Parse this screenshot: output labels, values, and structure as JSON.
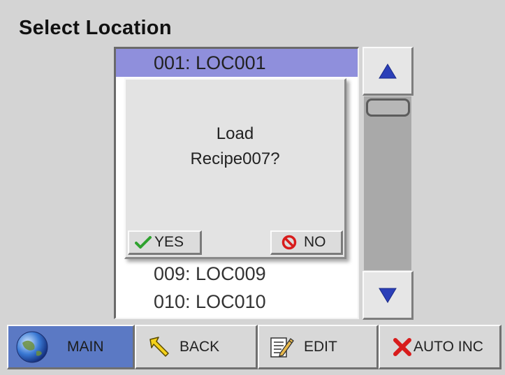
{
  "screen": {
    "title": "Select Location"
  },
  "locations": {
    "items": [
      {
        "label": "001:  LOC001"
      },
      {
        "label": "009:  LOC009"
      },
      {
        "label": "010:  LOC010"
      }
    ]
  },
  "dialog": {
    "line1": "Load",
    "line2": "Recipe007?",
    "yes_label": "YES",
    "no_label": "NO"
  },
  "toolbar": {
    "main_label": "MAIN",
    "back_label": "BACK",
    "edit_label": "EDIT",
    "autoinc_label": "AUTO INC"
  },
  "colors": {
    "selection": "#8f8fdc",
    "main_button": "#5b79c4",
    "arrow": "#2b3fb8"
  },
  "icons": {
    "scroll_up": "triangle-up-icon",
    "scroll_down": "triangle-down-icon",
    "yes": "checkmark-icon",
    "no": "no-entry-icon",
    "main": "globe-icon",
    "back": "back-arrow-icon",
    "edit": "notepad-pencil-icon",
    "autoinc": "red-x-icon"
  }
}
